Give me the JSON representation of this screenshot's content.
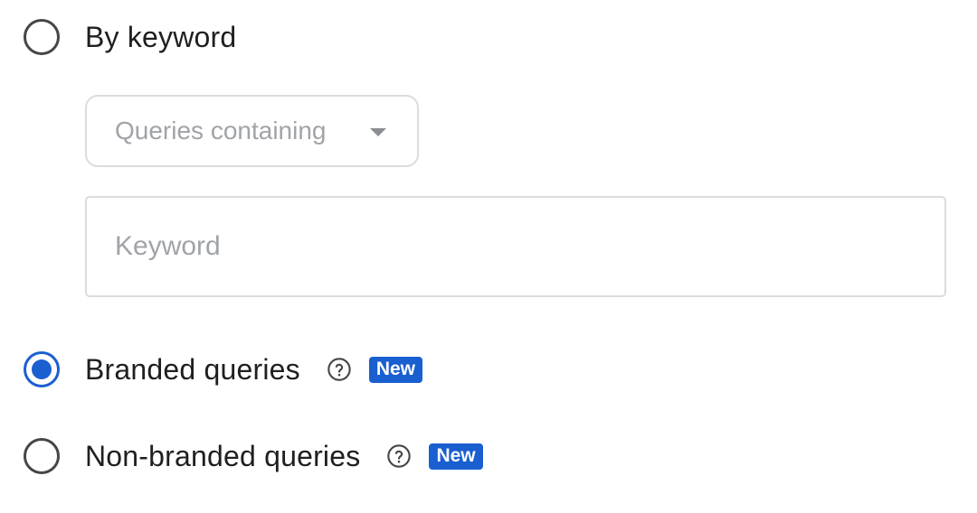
{
  "options": [
    {
      "label": "By keyword",
      "checked": false
    },
    {
      "label": "Branded queries",
      "checked": true,
      "badge": "New",
      "help_icon": "help-circle-icon"
    },
    {
      "label": "Non-branded queries",
      "checked": false,
      "badge": "New",
      "help_icon": "help-circle-icon"
    }
  ],
  "keyword_filter": {
    "match_type_selected": "Queries containing",
    "keyword_value": "",
    "keyword_placeholder": "Keyword"
  },
  "colors": {
    "accent": "#1a5fd0",
    "radio_border": "#444746",
    "placeholder": "#a0a3a8",
    "field_border": "#dadce0"
  }
}
